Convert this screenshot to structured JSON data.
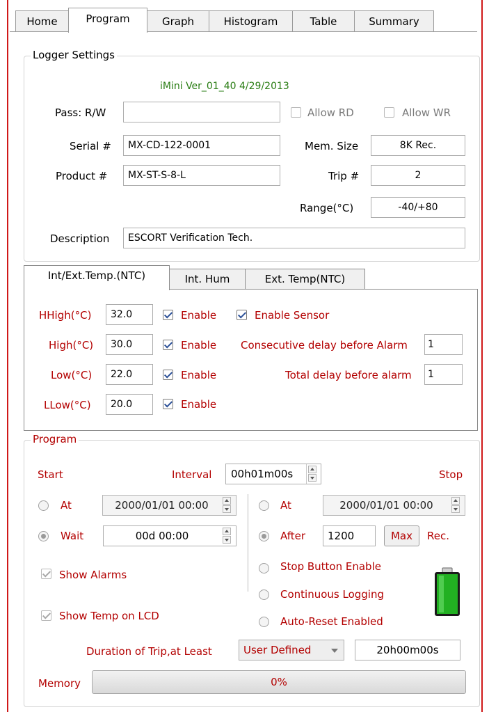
{
  "tabs": [
    "Home",
    "Program",
    "Graph",
    "Histogram",
    "Table",
    "Summary"
  ],
  "logger_settings": {
    "legend": "Logger Settings",
    "version": "iMini Ver_01_40 4/29/2013",
    "pass_label": "Pass: R/W",
    "pass_value": "",
    "allow_rd": "Allow RD",
    "allow_wr": "Allow WR",
    "serial_label": "Serial #",
    "serial_value": "MX-CD-122-0001",
    "mem_size_label": "Mem. Size",
    "mem_size_value": "8K Rec.",
    "product_label": "Product #",
    "product_value": "MX-ST-S-8-L",
    "trip_label": "Trip #",
    "trip_value": "2",
    "range_label": "Range(°C)",
    "range_value": "-40/+80",
    "description_label": "Description",
    "description_value": "ESCORT Verification Tech."
  },
  "sensor_tabs": [
    "Int/Ext.Temp.(NTC)",
    "Int. Hum",
    "Ext. Temp(NTC)"
  ],
  "thresholds": {
    "rows": [
      {
        "label": "HHigh(°C)",
        "value": "32.0",
        "enable": "Enable"
      },
      {
        "label": "High(°C)",
        "value": "30.0",
        "enable": "Enable"
      },
      {
        "label": "Low(°C)",
        "value": "22.0",
        "enable": "Enable"
      },
      {
        "label": "LLow(°C)",
        "value": "20.0",
        "enable": "Enable"
      }
    ],
    "enable_sensor": "Enable Sensor",
    "consecutive_label": "Consecutive delay before Alarm",
    "consecutive_value": "1",
    "total_label": "Total delay before alarm",
    "total_value": "1"
  },
  "program": {
    "legend": "Program",
    "start_label": "Start",
    "interval_label": "Interval",
    "interval_value": "00h01m00s",
    "stop_label": "Stop",
    "start_at_label": "At",
    "start_at_value": "2000/01/01 00:00",
    "wait_label": "Wait",
    "wait_value": "00d 00:00",
    "stop_at_label": "At",
    "stop_at_value": "2000/01/01 00:00",
    "after_label": "After",
    "after_value": "1200",
    "max_button": "Max",
    "rec_label": "Rec.",
    "show_alarms": "Show Alarms",
    "show_temp": "Show Temp on LCD",
    "stop_button_enable": "Stop Button Enable",
    "continuous_logging": "Continuous Logging",
    "auto_reset": "Auto-Reset Enabled",
    "duration_label": "Duration of Trip,at Least",
    "duration_select": "User Defined",
    "duration_value": "20h00m00s",
    "memory_label": "Memory",
    "memory_percent_text": "0%",
    "memory_fraction": 0
  },
  "colors": {
    "label_red": "#b30000",
    "version_green": "#2a7d14",
    "battery_green": "#22b022"
  }
}
